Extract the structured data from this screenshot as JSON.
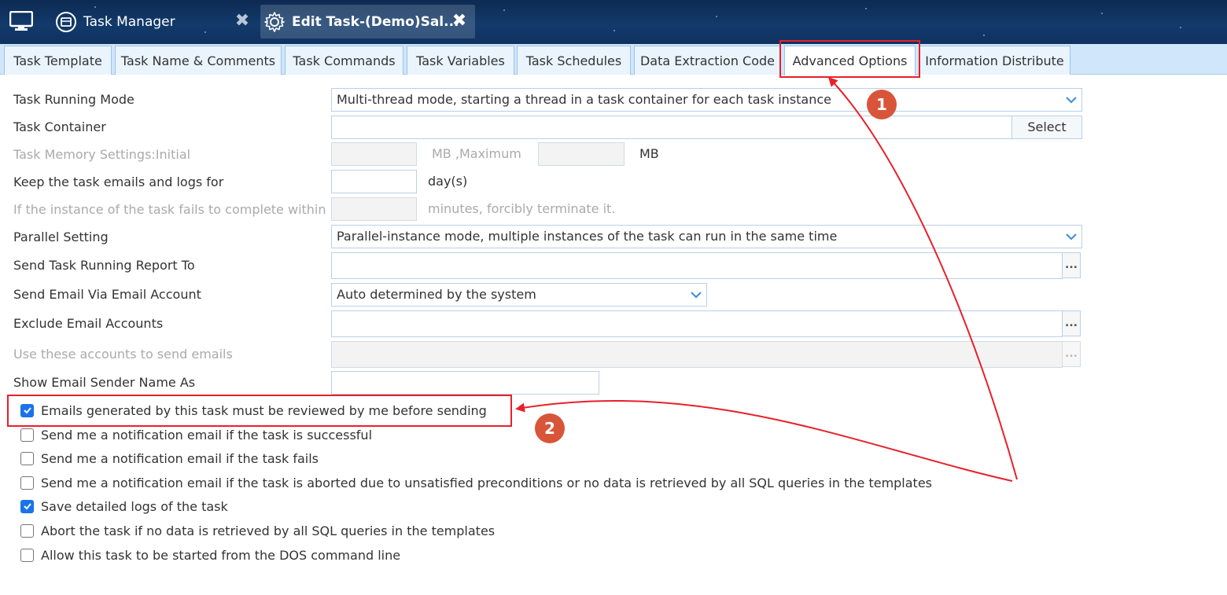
{
  "window_tabs": [
    {
      "label": "Task Manager",
      "icon": "task-manager-icon"
    },
    {
      "label": "Edit Task-(Demo)Sal...",
      "icon": "gear-icon"
    }
  ],
  "tabs": [
    "Task Template",
    "Task Name & Comments",
    "Task Commands",
    "Task Variables",
    "Task Schedules",
    "Data Extraction Code",
    "Advanced Options",
    "Information Distribute"
  ],
  "active_tab": "Advanced Options",
  "form": {
    "running_mode_label": "Task Running Mode",
    "running_mode_value": "Multi-thread mode, starting a thread in a task container for each task instance",
    "container_label": "Task Container",
    "container_value": "",
    "select_button": "Select",
    "memory_label": "Task Memory Settings:Initial",
    "memory_initial": "",
    "memory_mid": "MB ,Maximum",
    "memory_max": "",
    "memory_unit": "MB",
    "keep_label": "Keep the task emails and logs for",
    "keep_value": "",
    "keep_unit": "day(s)",
    "timeout_label": "If the instance of the task fails to complete within",
    "timeout_value": "",
    "timeout_unit": "minutes, forcibly terminate it.",
    "parallel_label": "Parallel Setting",
    "parallel_value": "Parallel-instance mode, multiple instances of the task can run in the same time",
    "report_label": "Send Task Running Report To",
    "report_value": "",
    "email_account_label": "Send Email Via Email Account",
    "email_account_value": "Auto determined by the system",
    "exclude_label": "Exclude Email Accounts",
    "exclude_value": "",
    "use_accounts_label": "Use these accounts to send emails",
    "use_accounts_value": "",
    "sender_name_label": "Show Email Sender Name As",
    "sender_name_value": "",
    "dots": "..."
  },
  "checkboxes": [
    {
      "label": "Emails generated by this task must be reviewed by me before sending",
      "checked": true
    },
    {
      "label": "Send me a notification email if the task is successful",
      "checked": false
    },
    {
      "label": "Send me a notification email if the task fails",
      "checked": false
    },
    {
      "label": "Send me a notification email if the task is aborted due to unsatisfied preconditions or no data is retrieved by all SQL queries in the templates",
      "checked": false
    },
    {
      "label": "Save detailed logs of the task",
      "checked": true
    },
    {
      "label": "Abort the task if no data is retrieved by all SQL queries in the templates",
      "checked": false
    },
    {
      "label": "Allow this task to be started from the DOS command line",
      "checked": false
    }
  ],
  "annotations": {
    "badge1": "1",
    "badge2": "2",
    "color": "#e8202a",
    "badge_color": "#d8553a"
  },
  "colors": {
    "tabstrip": "#cfe6fb",
    "checkbox_checked": "#1a73e8",
    "topbar": "#123a6b"
  }
}
